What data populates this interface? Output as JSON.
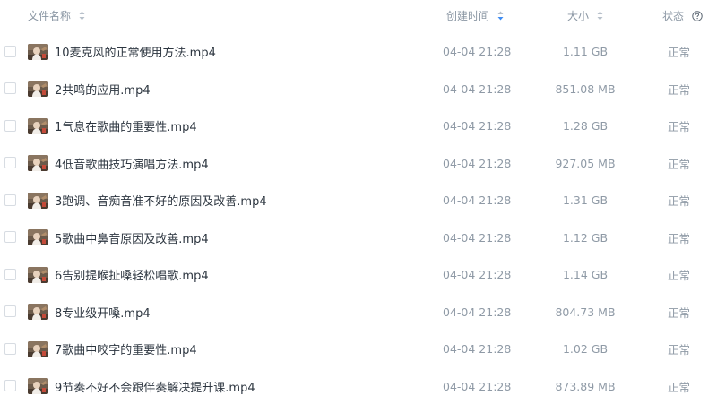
{
  "header": {
    "name_label": "文件名称",
    "time_label": "创建时间",
    "size_label": "大小",
    "status_label": "状态"
  },
  "colors": {
    "accent": "#3f8df3",
    "header_text": "#8a96a3",
    "filename_text": "#2d3640",
    "meta_text": "#8f9aa6"
  },
  "files": [
    {
      "name": "10麦克风的正常使用方法.mp4",
      "time": "04-04 21:28",
      "size": "1.11 GB",
      "status": "正常"
    },
    {
      "name": "2共鸣的应用.mp4",
      "time": "04-04 21:28",
      "size": "851.08 MB",
      "status": "正常"
    },
    {
      "name": "1气息在歌曲的重要性.mp4",
      "time": "04-04 21:28",
      "size": "1.28 GB",
      "status": "正常"
    },
    {
      "name": "4低音歌曲技巧演唱方法.mp4",
      "time": "04-04 21:28",
      "size": "927.05 MB",
      "status": "正常"
    },
    {
      "name": "3跑调、音痴音准不好的原因及改善.mp4",
      "time": "04-04 21:28",
      "size": "1.31 GB",
      "status": "正常"
    },
    {
      "name": "5歌曲中鼻音原因及改善.mp4",
      "time": "04-04 21:28",
      "size": "1.12 GB",
      "status": "正常"
    },
    {
      "name": "6告别提喉扯嗓轻松唱歌.mp4",
      "time": "04-04 21:28",
      "size": "1.14 GB",
      "status": "正常"
    },
    {
      "name": "8专业级开嗓.mp4",
      "time": "04-04 21:28",
      "size": "804.73 MB",
      "status": "正常"
    },
    {
      "name": "7歌曲中咬字的重要性.mp4",
      "time": "04-04 21:28",
      "size": "1.02 GB",
      "status": "正常"
    },
    {
      "name": "9节奏不好不会跟伴奏解决提升课.mp4",
      "time": "04-04 21:28",
      "size": "873.89 MB",
      "status": "正常"
    }
  ]
}
